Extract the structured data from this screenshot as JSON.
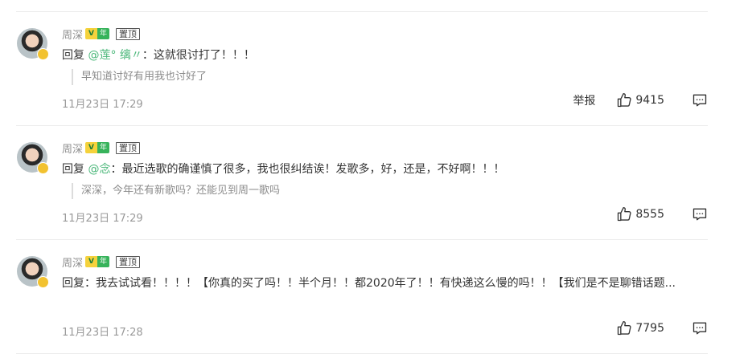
{
  "comments": [
    {
      "username": "周深",
      "vip_logo": "V",
      "vip_text": "年",
      "pin_label": "置顶",
      "reply_prefix": "回复",
      "mention": "@莲° 缡〃",
      "text": "：这就很讨打了！！！",
      "quote": "早知道讨好有用我也讨好了",
      "time": "11月23日 17:29",
      "report_label": "举报",
      "likes": "9415"
    },
    {
      "username": "周深",
      "vip_logo": "V",
      "vip_text": "年",
      "pin_label": "置顶",
      "reply_prefix": "回复",
      "mention": "@念",
      "text": "：最近选歌的确谨慎了很多，我也很纠结诶！发歌多，好，还是，不好啊！！！",
      "quote": "深深，今年还有新歌吗？还能见到周一歌吗",
      "time": "11月23日 17:29",
      "report_label": "",
      "likes": "8555"
    },
    {
      "username": "周深",
      "vip_logo": "V",
      "vip_text": "年",
      "pin_label": "置顶",
      "reply_prefix": "回复",
      "mention": "",
      "text": "：我去试试看！！！！【你真的买了吗！！半个月！！都2020年了！！有快递这么慢的吗！！【我们是不是聊错话题...",
      "quote": "",
      "time": "11月23日 17:28",
      "report_label": "",
      "likes": "7795"
    }
  ],
  "icons": {
    "like": "thumbs-up-icon",
    "reply": "comment-icon",
    "avatar_badge": "vip-badge-icon"
  },
  "colors": {
    "mention": "#4ab779",
    "vip_green": "#37b35b",
    "vip_yellow": "#f5d23c"
  }
}
